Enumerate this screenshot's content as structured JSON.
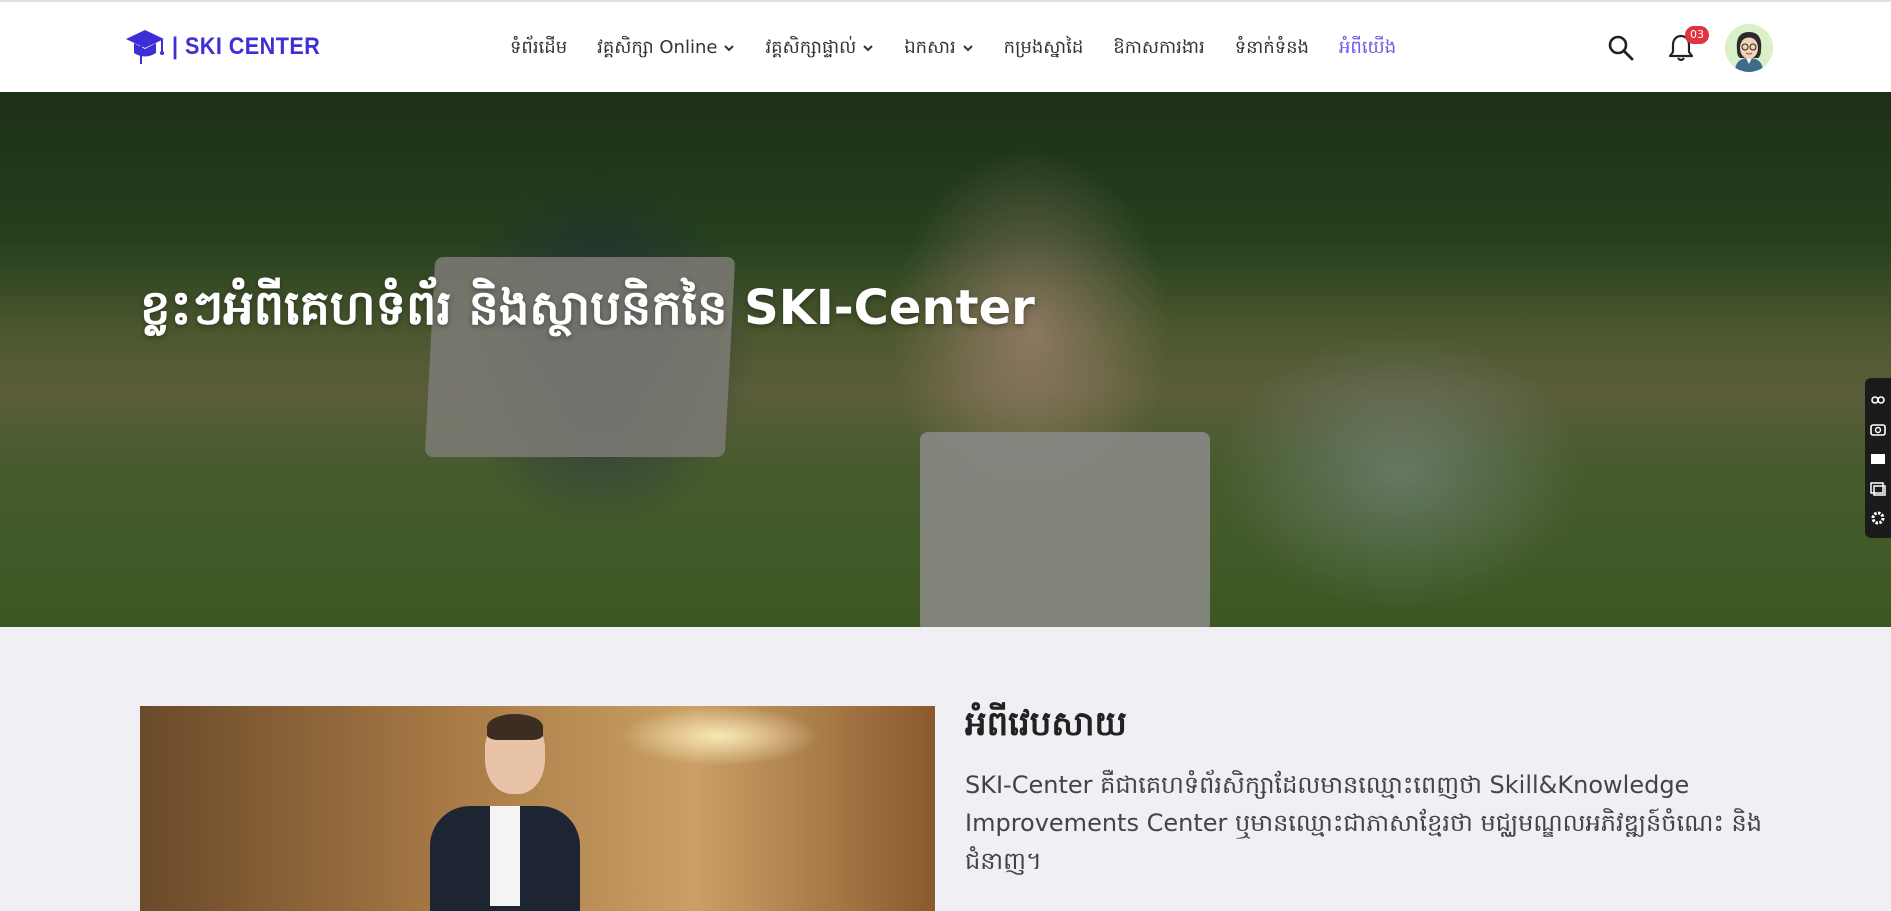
{
  "header": {
    "logo_text": "| SKI CENTER",
    "nav": [
      {
        "label": "ទំព័រដើម",
        "dropdown": false,
        "active": false
      },
      {
        "label": "វគ្គសិក្សា Online",
        "dropdown": true,
        "active": false
      },
      {
        "label": "វគ្គសិក្សាផ្ទាល់",
        "dropdown": true,
        "active": false
      },
      {
        "label": "ឯកសារ",
        "dropdown": true,
        "active": false
      },
      {
        "label": "កម្រងស្នាដៃ",
        "dropdown": false,
        "active": false
      },
      {
        "label": "ឱកាសការងារ",
        "dropdown": false,
        "active": false
      },
      {
        "label": "ទំនាក់ទំនង",
        "dropdown": false,
        "active": false
      },
      {
        "label": "អំពីយើង",
        "dropdown": false,
        "active": true
      }
    ],
    "notification_count": "03",
    "icons": [
      "search-icon",
      "bell-icon",
      "avatar"
    ]
  },
  "hero": {
    "title": "ខ្លះៗអំពីគេហទំព័រ និងស្ថាបនិកនៃ SKI-Center"
  },
  "about": {
    "title": "អំពីវេបសាយ",
    "paragraph": "SKI-Center គឺជាគេហទំព័រសិក្សាដែលមានឈ្មោះពេញថា Skill&Knowledge Improvements Center ឬមានឈ្មោះជាភាសាខ្មែរថា មជ្ឈមណ្ឌលអភិវឌ្ឍន៍ចំណេះ និងជំនាញ។"
  },
  "colors": {
    "brand": "#3d2ed6",
    "active_nav": "#6c5ce7",
    "badge": "#e0343f"
  }
}
